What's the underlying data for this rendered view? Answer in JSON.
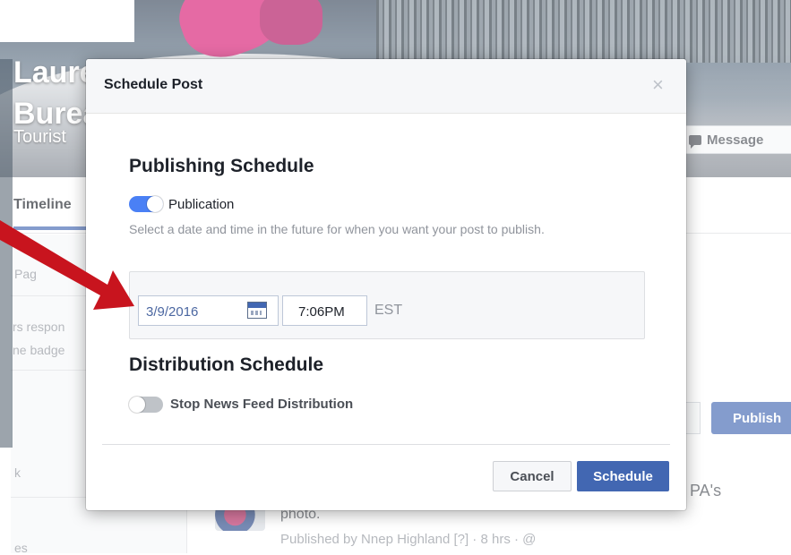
{
  "background_page": {
    "page_name": "Laurel Highlands Visitors Bureau",
    "category": "Tourist",
    "message_button": "Message",
    "tab_timeline": "Timeline",
    "left_col_snippets": [
      "Pag",
      "rs respon",
      "ne badge",
      "k",
      "es"
    ],
    "publish_button": "Publish",
    "post_title_tail": "PA's",
    "post_photo_word": "photo.",
    "post_meta": "Published by Nnep Highland [?] · 8 hrs · @"
  },
  "dialog": {
    "title": "Schedule Post",
    "close_symbol": "×",
    "publishing": {
      "heading": "Publishing Schedule",
      "toggle_label": "Publication",
      "toggle_state": "on",
      "help_text": "Select a date and time in the future for when you want your post to publish.",
      "date_value": "3/9/2016",
      "time_value": "7:06PM",
      "timezone": "EST"
    },
    "distribution": {
      "heading": "Distribution Schedule",
      "toggle_label": "Stop News Feed Distribution",
      "toggle_state": "off"
    },
    "cancel_label": "Cancel",
    "schedule_label": "Schedule"
  },
  "colors": {
    "primary_blue": "#4267b2",
    "toggle_on": "#4a80f5",
    "annotation_arrow": "#c8141e"
  },
  "icons": [
    "calendar-icon",
    "close-icon",
    "message-icon",
    "annotation-arrow"
  ]
}
